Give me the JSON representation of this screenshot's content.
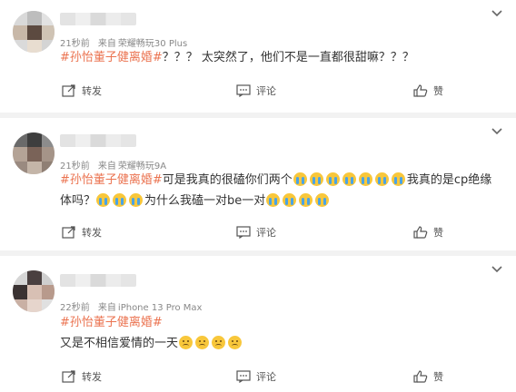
{
  "posts": [
    {
      "time": "21秒前",
      "source_prefix": "来自",
      "device": "荣耀畅玩30 Plus",
      "hashtag": "#孙怡董子健离婚#",
      "text": "？？？ 太突然了，他们不是一直都很甜嘛？？？",
      "repost_label": "转发",
      "comment_label": "评论",
      "like_label": "赞"
    },
    {
      "time": "21秒前",
      "source_prefix": "来自",
      "device": "荣耀畅玩9A",
      "hashtag": "#孙怡董子健离婚#",
      "text_a": "可是我真的很磕你们两个",
      "text_b": "我真的是cp绝缘体吗？",
      "text_c": "为什么我磕一对be一对",
      "repost_label": "转发",
      "comment_label": "评论",
      "like_label": "赞"
    },
    {
      "time": "22秒前",
      "source_prefix": "来自",
      "device": "iPhone 13 Pro Max",
      "hashtag": "#孙怡董子健离婚#",
      "text": "又是不相信爱情的一天",
      "repost_label": "转发",
      "comment_label": "评论",
      "like_label": "赞"
    }
  ],
  "icons": {
    "more": "chevron-down-icon",
    "repost": "repost-icon",
    "comment": "comment-icon",
    "like": "thumbs-up-icon",
    "emoji_cry": "crying-emoji",
    "emoji_sad": "sad-face-emoji"
  },
  "colors": {
    "hashtag": "#eb7350",
    "background": "#f2f2f2",
    "card": "#ffffff",
    "meta": "#888888"
  }
}
